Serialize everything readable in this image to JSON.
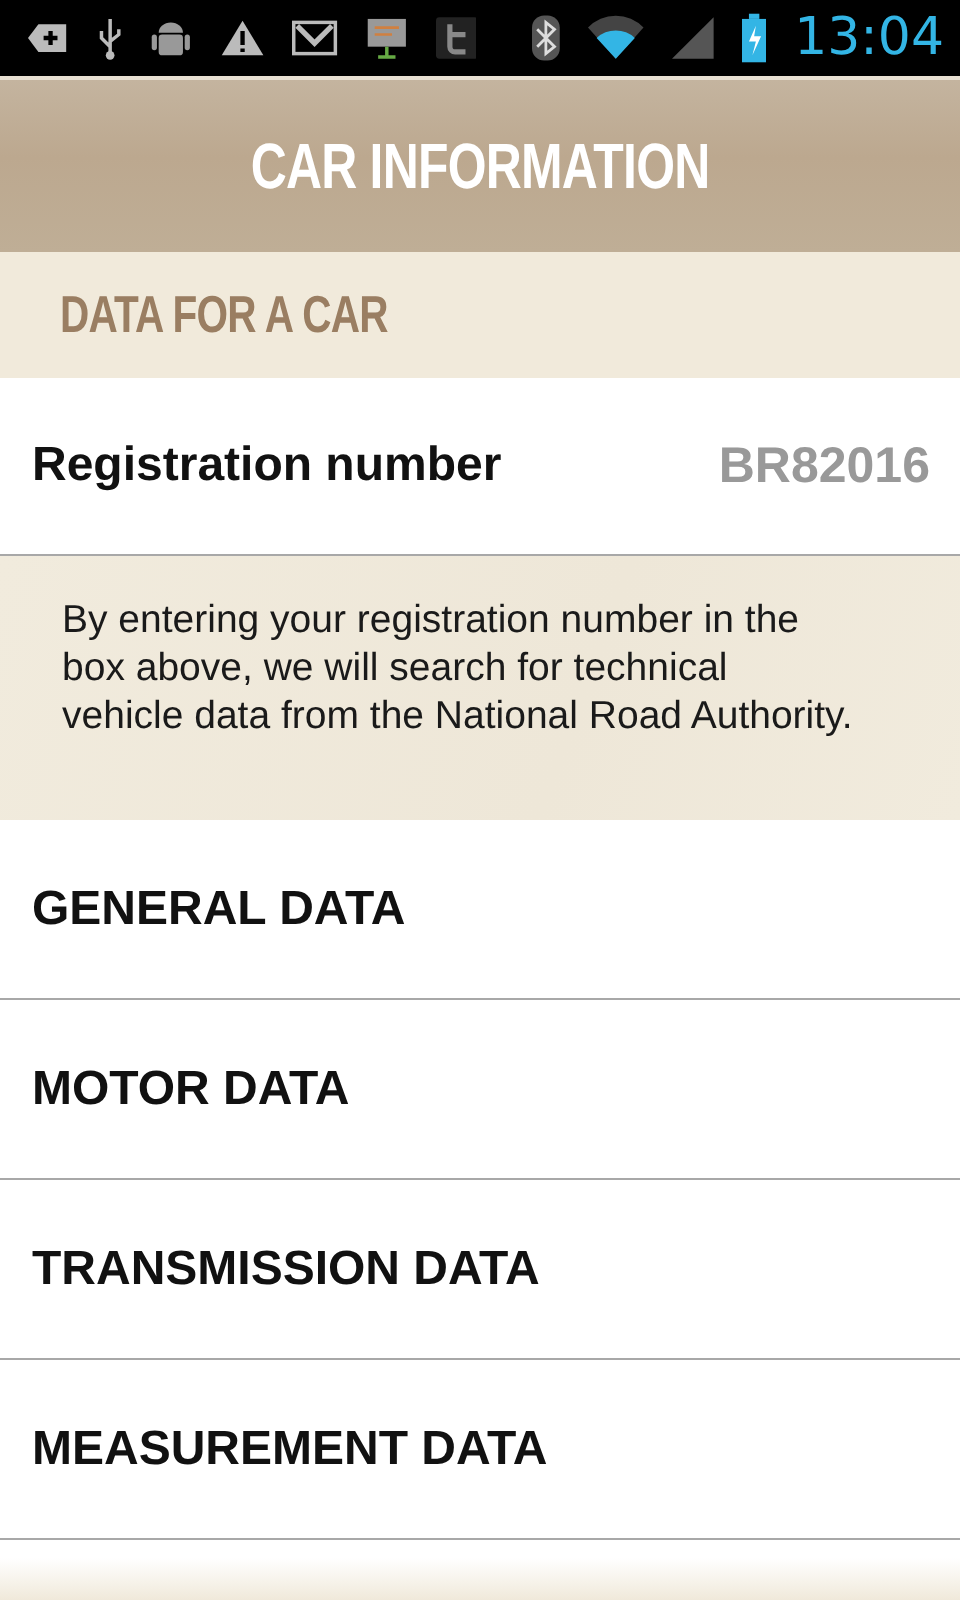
{
  "status_bar": {
    "time": "13:04"
  },
  "header": {
    "title": "CAR INFORMATION"
  },
  "section": {
    "title": "DATA FOR A CAR"
  },
  "registration": {
    "label": "Registration number",
    "value": "BR82016"
  },
  "info": "By entering your registration number in the box above, we will search for technical vehicle data from the National Road Authority.",
  "menu": [
    {
      "label": "GENERAL DATA"
    },
    {
      "label": "MOTOR DATA"
    },
    {
      "label": "TRANSMISSION DATA"
    },
    {
      "label": "MEASUREMENT DATA"
    }
  ]
}
